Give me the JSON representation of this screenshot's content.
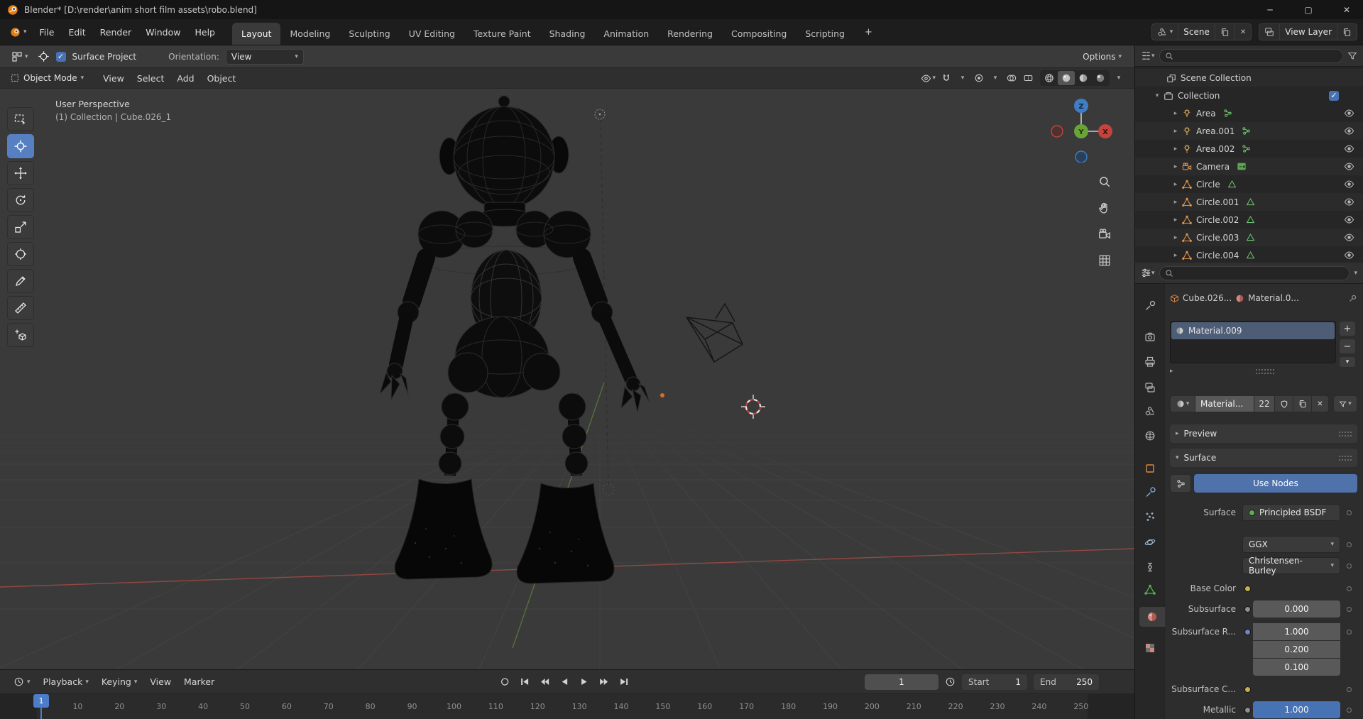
{
  "glyphs": {
    "chev": "▾",
    "tri_r": "▸",
    "tri_d": "▾",
    "close": "✕",
    "minimize": "─",
    "maximize": "▢",
    "plus": "+",
    "minus": "−",
    "check": "✓"
  },
  "colors": {
    "accent": "#4772b3",
    "blender_orange": "#e87d0d",
    "axis_x": "#c4433c",
    "axis_y": "#6ba436",
    "axis_z": "#3f7dc4"
  },
  "titlebar": {
    "title": "Blender* [D:\\render\\anim short film assets\\robo.blend]"
  },
  "menubar": {
    "menus": [
      "File",
      "Edit",
      "Render",
      "Window",
      "Help"
    ],
    "tabs": [
      {
        "label": "Layout",
        "active": true
      },
      {
        "label": "Modeling"
      },
      {
        "label": "Sculpting"
      },
      {
        "label": "UV Editing"
      },
      {
        "label": "Texture Paint"
      },
      {
        "label": "Shading"
      },
      {
        "label": "Animation"
      },
      {
        "label": "Rendering"
      },
      {
        "label": "Compositing"
      },
      {
        "label": "Scripting"
      }
    ],
    "add_workspace": "+",
    "scene_name": "Scene",
    "view_layer_name": "View Layer"
  },
  "tool_settings": {
    "surface_project_label": "Surface Project",
    "orientation_label": "Orientation:",
    "orientation_value": "View",
    "options_label": "Options"
  },
  "viewport": {
    "mode": "Object Mode",
    "menus": [
      "View",
      "Select",
      "Add",
      "Object"
    ],
    "overlay_line1": "User Perspective",
    "overlay_line2": "(1) Collection | Cube.026_1",
    "gizmo": {
      "x": "X",
      "y": "Y",
      "z": "Z"
    }
  },
  "outliner": {
    "scene_collection": "Scene Collection",
    "collection": "Collection",
    "items": [
      {
        "name": "Area",
        "type": "light"
      },
      {
        "name": "Area.001",
        "type": "light"
      },
      {
        "name": "Area.002",
        "type": "light"
      },
      {
        "name": "Camera",
        "type": "camera"
      },
      {
        "name": "Circle",
        "type": "mesh"
      },
      {
        "name": "Circle.001",
        "type": "mesh"
      },
      {
        "name": "Circle.002",
        "type": "mesh"
      },
      {
        "name": "Circle.003",
        "type": "mesh"
      },
      {
        "name": "Circle.004",
        "type": "mesh"
      }
    ]
  },
  "properties": {
    "breadcrumb_object": "Cube.026...",
    "breadcrumb_material": "Material.0...",
    "slot_name": "Material.009",
    "material_name": "Material...",
    "user_count": "22",
    "preview_label": "Preview",
    "surface_section_label": "Surface",
    "use_nodes_label": "Use Nodes",
    "surface_label": "Surface",
    "surface_value": "Principled BSDF",
    "distribution_value": "GGX",
    "subsurface_method_value": "Christensen-Burley",
    "base_color_label": "Base Color",
    "subsurface_label": "Subsurface",
    "subsurface_value": "0.000",
    "subsurface_radius_label": "Subsurface R...",
    "subsurface_radius_values": [
      "1.000",
      "0.200",
      "0.100"
    ],
    "subsurface_color_label": "Subsurface C...",
    "metallic_label": "Metallic",
    "metallic_value": "1.000"
  },
  "timeline": {
    "menus_pop": [
      "Playback",
      "Keying"
    ],
    "menus_plain": [
      "View",
      "Marker"
    ],
    "frame_field": "1",
    "start_label": "Start",
    "start_value": "1",
    "end_label": "End",
    "end_value": "250",
    "current": "1",
    "ruler": [
      "10",
      "20",
      "30",
      "40",
      "50",
      "60",
      "70",
      "80",
      "90",
      "100",
      "110",
      "120",
      "130",
      "140",
      "150",
      "160",
      "170",
      "180",
      "190",
      "200",
      "210",
      "220",
      "230",
      "240",
      "250"
    ]
  }
}
